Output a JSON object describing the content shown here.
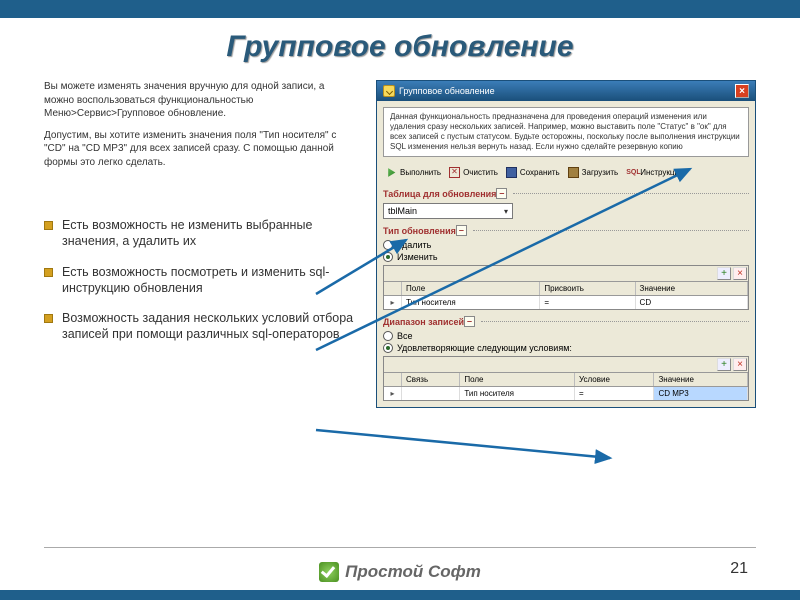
{
  "title": "Групповое обновление",
  "intro": {
    "p1": "Вы можете изменять значения вручную для одной записи, а можно воспользоваться функциональностью Меню>Сервис>Групповое обновление.",
    "p2": "Допустим, вы хотите изменить значения поля \"Тип носителя\" с \"CD\" на \"CD MP3\" для всех записей сразу. С помощью данной формы это легко сделать."
  },
  "bullets": [
    "Есть возможность не изменить выбранные значения, а удалить их",
    "Есть возможность посмотреть и изменить sql-инструкцию обновления",
    "Возможность задания нескольких условий отбора записей при помощи различных sql-операторов"
  ],
  "win": {
    "title": "Групповое обновление",
    "desc": "Данная функциональность предназначена для проведения операций изменения или удаления сразу нескольких записей. Например, можно выставить поле \"Статус\" в \"ок\" для всех записей с пустым статусом. Будьте осторожны, поскольку после выполнения инструкции SQL изменения нельзя вернуть назад. Если нужно сделайте резервную копию",
    "toolbar": {
      "run": "Выполнить",
      "clear": "Очистить",
      "save": "Сохранить",
      "load": "Загрузить",
      "sql": "Инструкция",
      "sql_label": "SQL"
    },
    "sections": {
      "table": "Таблица для обновления",
      "type": "Тип обновления",
      "range": "Диапазон записей"
    },
    "table_dd": "tblMain",
    "type_opts": {
      "del": "Удалить",
      "mod": "Изменить"
    },
    "grid1": {
      "headers": {
        "field": "Поле",
        "assign": "Присвоить",
        "value": "Значение"
      },
      "row": {
        "field": "Тип носителя",
        "assign": "=",
        "value": "CD"
      }
    },
    "range_opts": {
      "all": "Все",
      "cond": "Удовлетворяющие следующим условиям:"
    },
    "grid2": {
      "headers": {
        "link": "Связь",
        "field": "Поле",
        "cond": "Условие",
        "value": "Значение"
      },
      "row": {
        "link": "",
        "field": "Тип носителя",
        "cond": "=",
        "value": "CD MP3"
      }
    }
  },
  "footer": {
    "logo": "Простой Софт",
    "page": "21"
  }
}
